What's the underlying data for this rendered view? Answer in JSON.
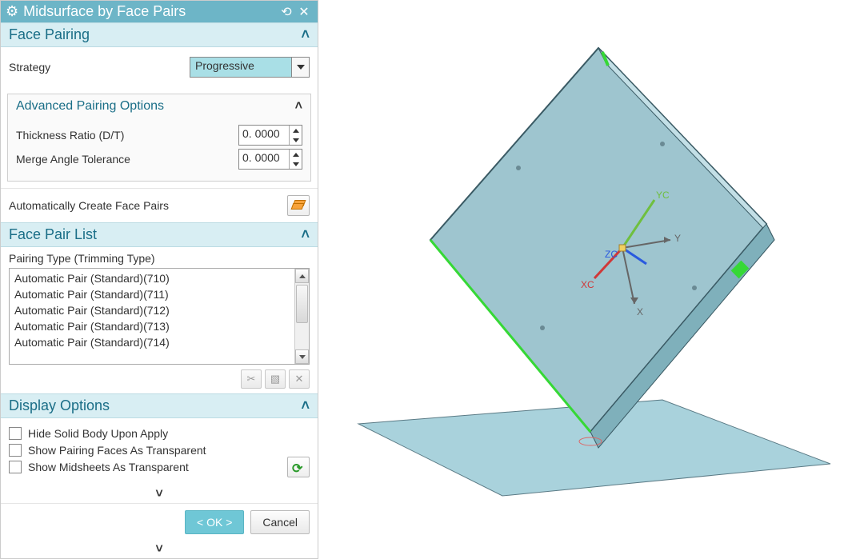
{
  "titlebar": {
    "title": "Midsurface by Face Pairs"
  },
  "facePairing": {
    "header": "Face Pairing",
    "strategyLabel": "Strategy",
    "strategyValue": "Progressive",
    "advanced": {
      "header": "Advanced Pairing Options",
      "thicknessLabel": "Thickness Ratio (D/T)",
      "thicknessValue": "0. 0000",
      "mergeLabel": "Merge Angle Tolerance",
      "mergeValue": "0. 0000"
    },
    "autoCreate": "Automatically Create Face Pairs"
  },
  "facePairList": {
    "header": "Face Pair List",
    "pairingTypeLabel": "Pairing Type (Trimming Type)",
    "items": [
      "Automatic Pair (Standard)(710)",
      "Automatic Pair (Standard)(711)",
      "Automatic Pair (Standard)(712)",
      "Automatic Pair (Standard)(713)",
      "Automatic Pair (Standard)(714)"
    ]
  },
  "displayOptions": {
    "header": "Display Options",
    "hideSolid": "Hide Solid Body Upon Apply",
    "showPairing": "Show Pairing Faces As Transparent",
    "showMidsheets": "Show Midsheets As Transparent"
  },
  "footer": {
    "ok": "< OK >",
    "cancel": "Cancel"
  },
  "viewer": {
    "axes": {
      "x": "X",
      "y": "Y",
      "xc": "XC",
      "yc": "YC",
      "zc": "ZC"
    }
  }
}
